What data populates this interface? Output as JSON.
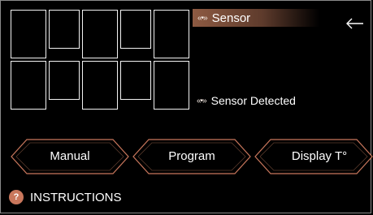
{
  "status": {
    "top_icon": "wireless-sensor-icon",
    "top_text": "Sensor",
    "bottom_icon": "wireless-sensor-icon",
    "bottom_text": "Sensor Detected",
    "wave_glyph": "«•»"
  },
  "nav": {
    "back_icon": "back-arrow-icon"
  },
  "buttons": [
    {
      "label": "Manual"
    },
    {
      "label": "Program"
    },
    {
      "label": "Display T°"
    }
  ],
  "instructions": {
    "badge": "?",
    "label": "INSTRUCTIONS"
  },
  "colors": {
    "accent": "#c9775c",
    "status_bar": "#8d5a42",
    "button_border": "#c9775c",
    "slot_border": "#f2f2f2",
    "background": "#000000"
  }
}
